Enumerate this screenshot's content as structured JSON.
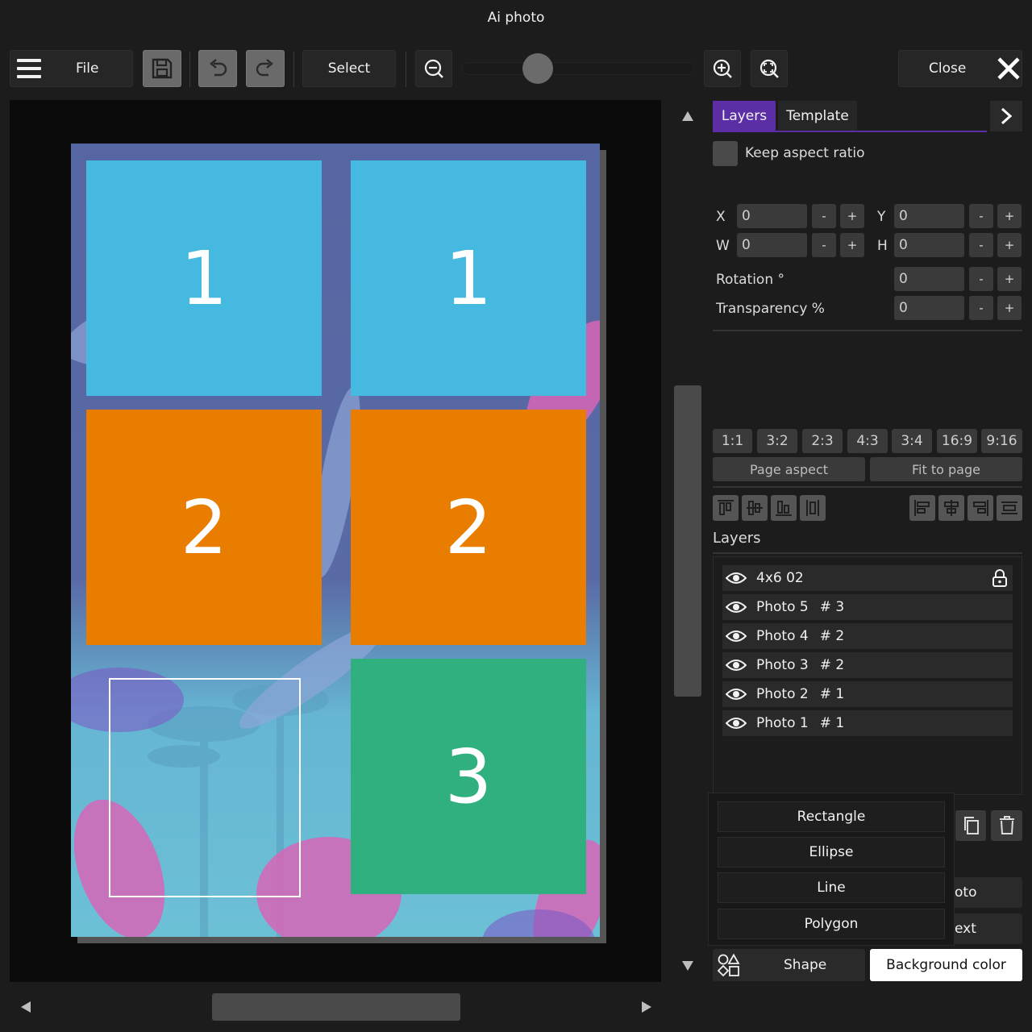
{
  "window": {
    "title": "Ai photo"
  },
  "toolbar": {
    "menu_icon": "hamburger-icon",
    "file_label": "File",
    "save_icon": "save-icon",
    "undo_icon": "undo-icon",
    "redo_icon": "redo-icon",
    "select_label": "Select",
    "zoom_out_icon": "zoom-out-icon",
    "zoom_in_icon": "zoom-in-icon",
    "zoom_fit_icon": "zoom-fit-icon",
    "close_label": "Close",
    "close_icon": "close-icon"
  },
  "canvas": {
    "slots": [
      {
        "label": "1",
        "color": "#45b9e0"
      },
      {
        "label": "1",
        "color": "#45b9e0"
      },
      {
        "label": "2",
        "color": "#e87d00"
      },
      {
        "label": "2",
        "color": "#e87d00"
      },
      {
        "label": "3",
        "color": "#30b07f"
      }
    ]
  },
  "panel": {
    "tabs": [
      {
        "label": "Layers",
        "active": true
      },
      {
        "label": "Template",
        "active": false
      }
    ],
    "keep_aspect_label": "Keep aspect ratio",
    "x_label": "X",
    "x_value": "0",
    "y_label": "Y",
    "y_value": "0",
    "w_label": "W",
    "w_value": "0",
    "h_label": "H",
    "h_value": "0",
    "rotation_label": "Rotation °",
    "rotation_value": "0",
    "transparency_label": "Transparency %",
    "transparency_value": "0",
    "minus": "-",
    "plus": "+",
    "ratios": [
      "1:1",
      "3:2",
      "2:3",
      "4:3",
      "3:4",
      "16:9",
      "9:16"
    ],
    "page_aspect_label": "Page aspect",
    "fit_to_page_label": "Fit to page",
    "layers_heading": "Layers",
    "layers": [
      {
        "name": "4x6 02",
        "num": "",
        "locked": true
      },
      {
        "name": "Photo 5",
        "num": "# 3",
        "locked": false
      },
      {
        "name": "Photo 4",
        "num": "# 2",
        "locked": false
      },
      {
        "name": "Photo 3",
        "num": "# 2",
        "locked": false
      },
      {
        "name": "Photo 2",
        "num": "# 1",
        "locked": false
      },
      {
        "name": "Photo 1",
        "num": "# 1",
        "locked": false
      }
    ],
    "shape_menu": [
      "Rectangle",
      "Ellipse",
      "Line",
      "Polygon"
    ],
    "hidden_photo_text": "oto",
    "hidden_text_text": "ext",
    "shape_label": "Shape",
    "background_color_label": "Background color"
  },
  "colors": {
    "accent_tab": "#5b2ea6",
    "panel_bg": "#1c1c1c"
  }
}
